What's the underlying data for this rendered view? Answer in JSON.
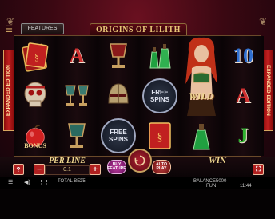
{
  "game": {
    "title": "ORIGINS OF LILITH",
    "features_label": "FEATURES",
    "banner_text": "EXPANDED EDITION"
  },
  "reels": [
    [
      {
        "symbol": "spell-book",
        "label": ""
      },
      {
        "symbol": "skull",
        "label": ""
      },
      {
        "symbol": "apple",
        "label": "BONUS"
      }
    ],
    [
      {
        "symbol": "card-A",
        "label": "A",
        "color": "#d03030"
      },
      {
        "symbol": "goblets",
        "label": ""
      },
      {
        "symbol": "goblet",
        "label": ""
      }
    ],
    [
      {
        "symbol": "goblet",
        "label": ""
      },
      {
        "symbol": "helmet",
        "label": ""
      },
      {
        "symbol": "free-spins",
        "label": "FREE SPINS"
      }
    ],
    [
      {
        "symbol": "potions",
        "label": ""
      },
      {
        "symbol": "free-spins",
        "label": "FREE SPINS"
      },
      {
        "symbol": "spell-book",
        "label": ""
      }
    ],
    [
      {
        "symbol": "lilith-wild",
        "label": "WILD"
      },
      {
        "symbol": "lilith-wild",
        "label": ""
      },
      {
        "symbol": "potion",
        "label": ""
      }
    ],
    [
      {
        "symbol": "card-10",
        "label": "10",
        "color": "#3070d0"
      },
      {
        "symbol": "card-A",
        "label": "A",
        "color": "#d03030"
      },
      {
        "symbol": "card-J",
        "label": "J",
        "color": "#30b030"
      }
    ]
  ],
  "controls": {
    "help_label": "?",
    "minus_label": "−",
    "plus_label": "+",
    "per_line_label": "PER LINE",
    "per_line_value": "0.1",
    "buy_feature_label": "BUY FEATURE",
    "auto_play_label": "AUTO PLAY",
    "win_label": "WIN",
    "fullscreen_label": "⛶"
  },
  "status": {
    "menu_icon": "hamburger-icon",
    "sound_icon": "speaker-icon",
    "settings_icon": "sliders-icon",
    "total_bet_label": "TOTAL BET",
    "total_bet_value": "25",
    "balance_label": "BALANCE",
    "balance_value": "5000",
    "currency": "FUN",
    "clock": "11:44"
  },
  "colors": {
    "accent_gold": "#e8c878",
    "button_red": "#b02020",
    "background_red": "#3a0812"
  }
}
